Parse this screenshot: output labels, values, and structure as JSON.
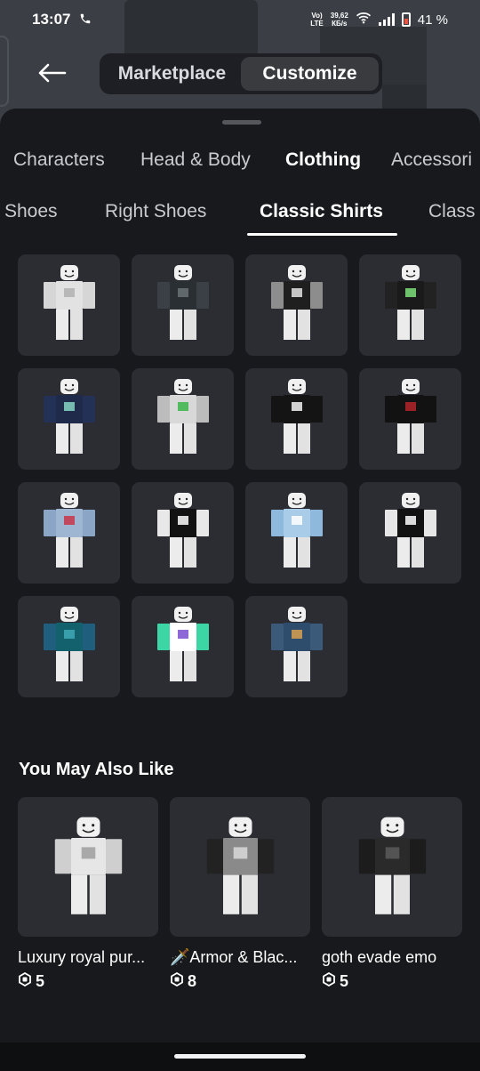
{
  "status_bar": {
    "time": "13:07",
    "network_top": "Vo)",
    "network_bottom": "LTE",
    "speed_top": "39,62",
    "speed_bottom": "КБ/s",
    "battery": "41 %"
  },
  "header": {
    "back_icon": "arrow-left-icon",
    "segments": [
      {
        "label": "Marketplace",
        "active": false
      },
      {
        "label": "Customize",
        "active": true
      }
    ]
  },
  "category_tabs": [
    {
      "label": "Characters",
      "active": false
    },
    {
      "label": "Head & Body",
      "active": false
    },
    {
      "label": "Clothing",
      "active": true
    },
    {
      "label": "Accessori",
      "active": false
    }
  ],
  "sub_tabs": [
    {
      "label": "Shoes",
      "active": false
    },
    {
      "label": "Right Shoes",
      "active": false
    },
    {
      "label": "Classic Shirts",
      "active": true
    },
    {
      "label": "Class",
      "active": false
    }
  ],
  "shirts": [
    {
      "torso": "#e2e2e2",
      "arms": "#d6d6d6",
      "accent": "#b0b0b0"
    },
    {
      "torso": "#2a2f33",
      "arms": "#3a4045",
      "accent": "#6a7277"
    },
    {
      "torso": "#1f1f1f",
      "arms": "#8d8d8d",
      "accent": "#e4e4e4"
    },
    {
      "torso": "#1a1a1a",
      "arms": "#222222",
      "accent": "#7de07a"
    },
    {
      "torso": "#1f2a4a",
      "arms": "#243156",
      "accent": "#86d3c3"
    },
    {
      "torso": "#d8d8d8",
      "arms": "#bcbcbc",
      "accent": "#3bb54a"
    },
    {
      "torso": "#141414",
      "arms": "#141414",
      "accent": "#f1f1f1"
    },
    {
      "torso": "#121212",
      "arms": "#121212",
      "accent": "#b3262b"
    },
    {
      "torso": "#9fb6d2",
      "arms": "#8aa5c6",
      "accent": "#c8354a"
    },
    {
      "torso": "#121212",
      "arms": "#e8e8e8",
      "accent": "#ffffff"
    },
    {
      "torso": "#a9cde8",
      "arms": "#8fb9dc",
      "accent": "#ffffff"
    },
    {
      "torso": "#121212",
      "arms": "#e6e6e6",
      "accent": "#ffffff"
    },
    {
      "torso": "#14616e",
      "arms": "#1f5f7d",
      "accent": "#3fa9b6"
    },
    {
      "torso": "#ffffff",
      "arms": "#3bd6a4",
      "accent": "#7b4ed1"
    },
    {
      "torso": "#2e4d6d",
      "arms": "#3b5a7a",
      "accent": "#d8a050"
    }
  ],
  "recommendations": {
    "title": "You May Also Like",
    "items": [
      {
        "name": "Luxury royal pur...",
        "price": "5",
        "torso": "#e6e6e6",
        "arms": "#cfcfcf",
        "accent": "#9e9e9e"
      },
      {
        "name": "🗡️Armor & Blac...",
        "price": "8",
        "torso": "#8a8a8a",
        "arms": "#222222",
        "accent": "#d9d9d9"
      },
      {
        "name": "goth evade emo",
        "price": "5",
        "torso": "#2a2a2a",
        "arms": "#1c1c1c",
        "accent": "#5a5a5a"
      }
    ]
  }
}
